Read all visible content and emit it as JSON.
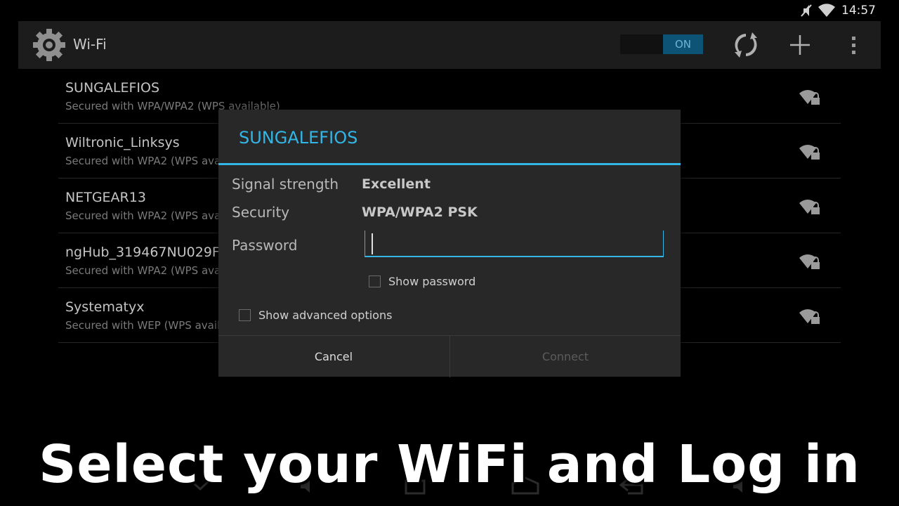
{
  "status_bar": {
    "time": "14:57",
    "icons": [
      "muted-icon",
      "wifi-icon"
    ]
  },
  "action_bar": {
    "title": "Wi-Fi",
    "toggle_label": "ON",
    "icons": [
      "settings-icon",
      "wps-icon",
      "add-icon",
      "overflow-menu-icon"
    ]
  },
  "networks": [
    {
      "name": "SUNGALEFIOS",
      "security": "Secured with WPA/WPA2 (WPS available)"
    },
    {
      "name": "Wiltronic_Linksys",
      "security": "Secured with WPA2 (WPS ava"
    },
    {
      "name": "NETGEAR13",
      "security": "Secured with WPA2 (WPS ava"
    },
    {
      "name": "ngHub_319467NU029F",
      "security": "Secured with WPA2 (WPS ava"
    },
    {
      "name": "Systematyx",
      "security": "Secured with WEP (WPS avail"
    }
  ],
  "dialog": {
    "title": "SUNGALEFIOS",
    "signal_label": "Signal strength",
    "signal_value": "Excellent",
    "security_label": "Security",
    "security_value": "WPA/WPA2 PSK",
    "password_label": "Password",
    "password_value": "",
    "show_password": "Show password",
    "show_advanced": "Show advanced options",
    "cancel": "Cancel",
    "connect": "Connect"
  },
  "accent_color": "#33b5e5",
  "caption": "Select your WiFi and Log in"
}
